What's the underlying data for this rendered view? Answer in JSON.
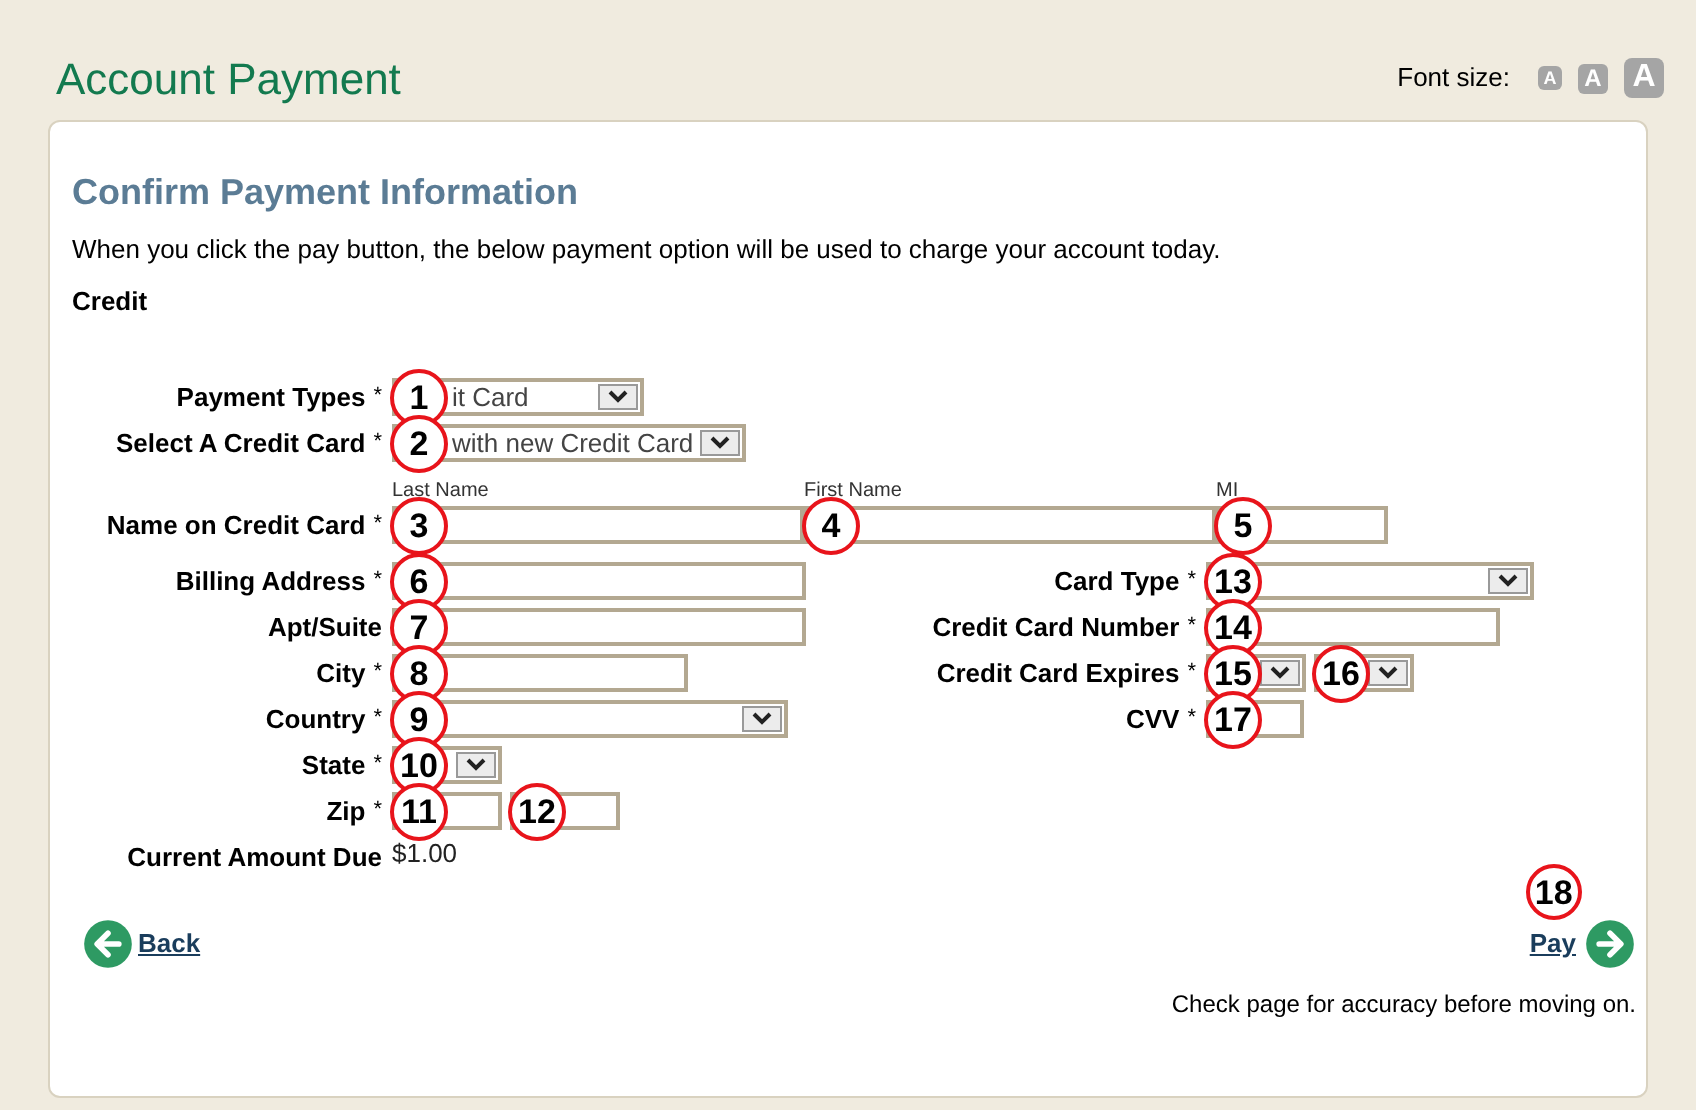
{
  "page_title": "Account Payment",
  "font_size": {
    "label": "Font size:",
    "options": [
      "A",
      "A",
      "A"
    ]
  },
  "section_title": "Confirm Payment Information",
  "intro": "When you click the pay button, the below payment option will be used to charge your account today.",
  "payment_method": "Credit",
  "top_fields": [
    {
      "label": "Payment Types",
      "required_mark": "*",
      "kind": "select",
      "value": "it Card",
      "callout": "1"
    },
    {
      "label": "Select A Credit Card",
      "required_mark": "*",
      "kind": "select",
      "value": "with new Credit Card",
      "callout": "2"
    }
  ],
  "name_row": {
    "label": "Name on Credit Card",
    "required_mark": "*",
    "parts": [
      {
        "caption": "Last Name",
        "callout": "3"
      },
      {
        "caption": "First Name",
        "callout": "4"
      },
      {
        "caption": "MI",
        "callout": "5"
      }
    ]
  },
  "left_fields": [
    {
      "label": "Billing Address",
      "required_mark": "*",
      "kind": "text",
      "callout": "6"
    },
    {
      "label": "Apt/Suite",
      "kind": "text",
      "callout": "7"
    },
    {
      "label": "City",
      "required_mark": "*",
      "kind": "text",
      "callout": "8"
    },
    {
      "label": "Country",
      "required_mark": "*",
      "kind": "select",
      "callout": "9"
    },
    {
      "label": "State",
      "required_mark": "*",
      "kind": "select",
      "callout": "10"
    },
    {
      "label": "Zip",
      "required_mark": "*",
      "kind": "text_pair",
      "callouts": [
        "11",
        "12"
      ]
    },
    {
      "label": "Current Amount Due",
      "kind": "amount",
      "value": "$1.00"
    }
  ],
  "right_fields": [
    {
      "label": "Card Type",
      "required_mark": "*",
      "kind": "select",
      "callout": "13"
    },
    {
      "label": "Credit Card Number",
      "required_mark": "*",
      "kind": "text",
      "callout": "14"
    },
    {
      "label": "Credit Card Expires",
      "required_mark": "*",
      "kind": "select_pair",
      "callouts": [
        "15",
        "16"
      ]
    },
    {
      "label": "CVV",
      "required_mark": "*",
      "kind": "text",
      "callout": "17"
    }
  ],
  "back_link": "Back",
  "pay_link": {
    "label": "Pay",
    "callout": "18"
  },
  "note": "Check page for accuracy before moving on."
}
